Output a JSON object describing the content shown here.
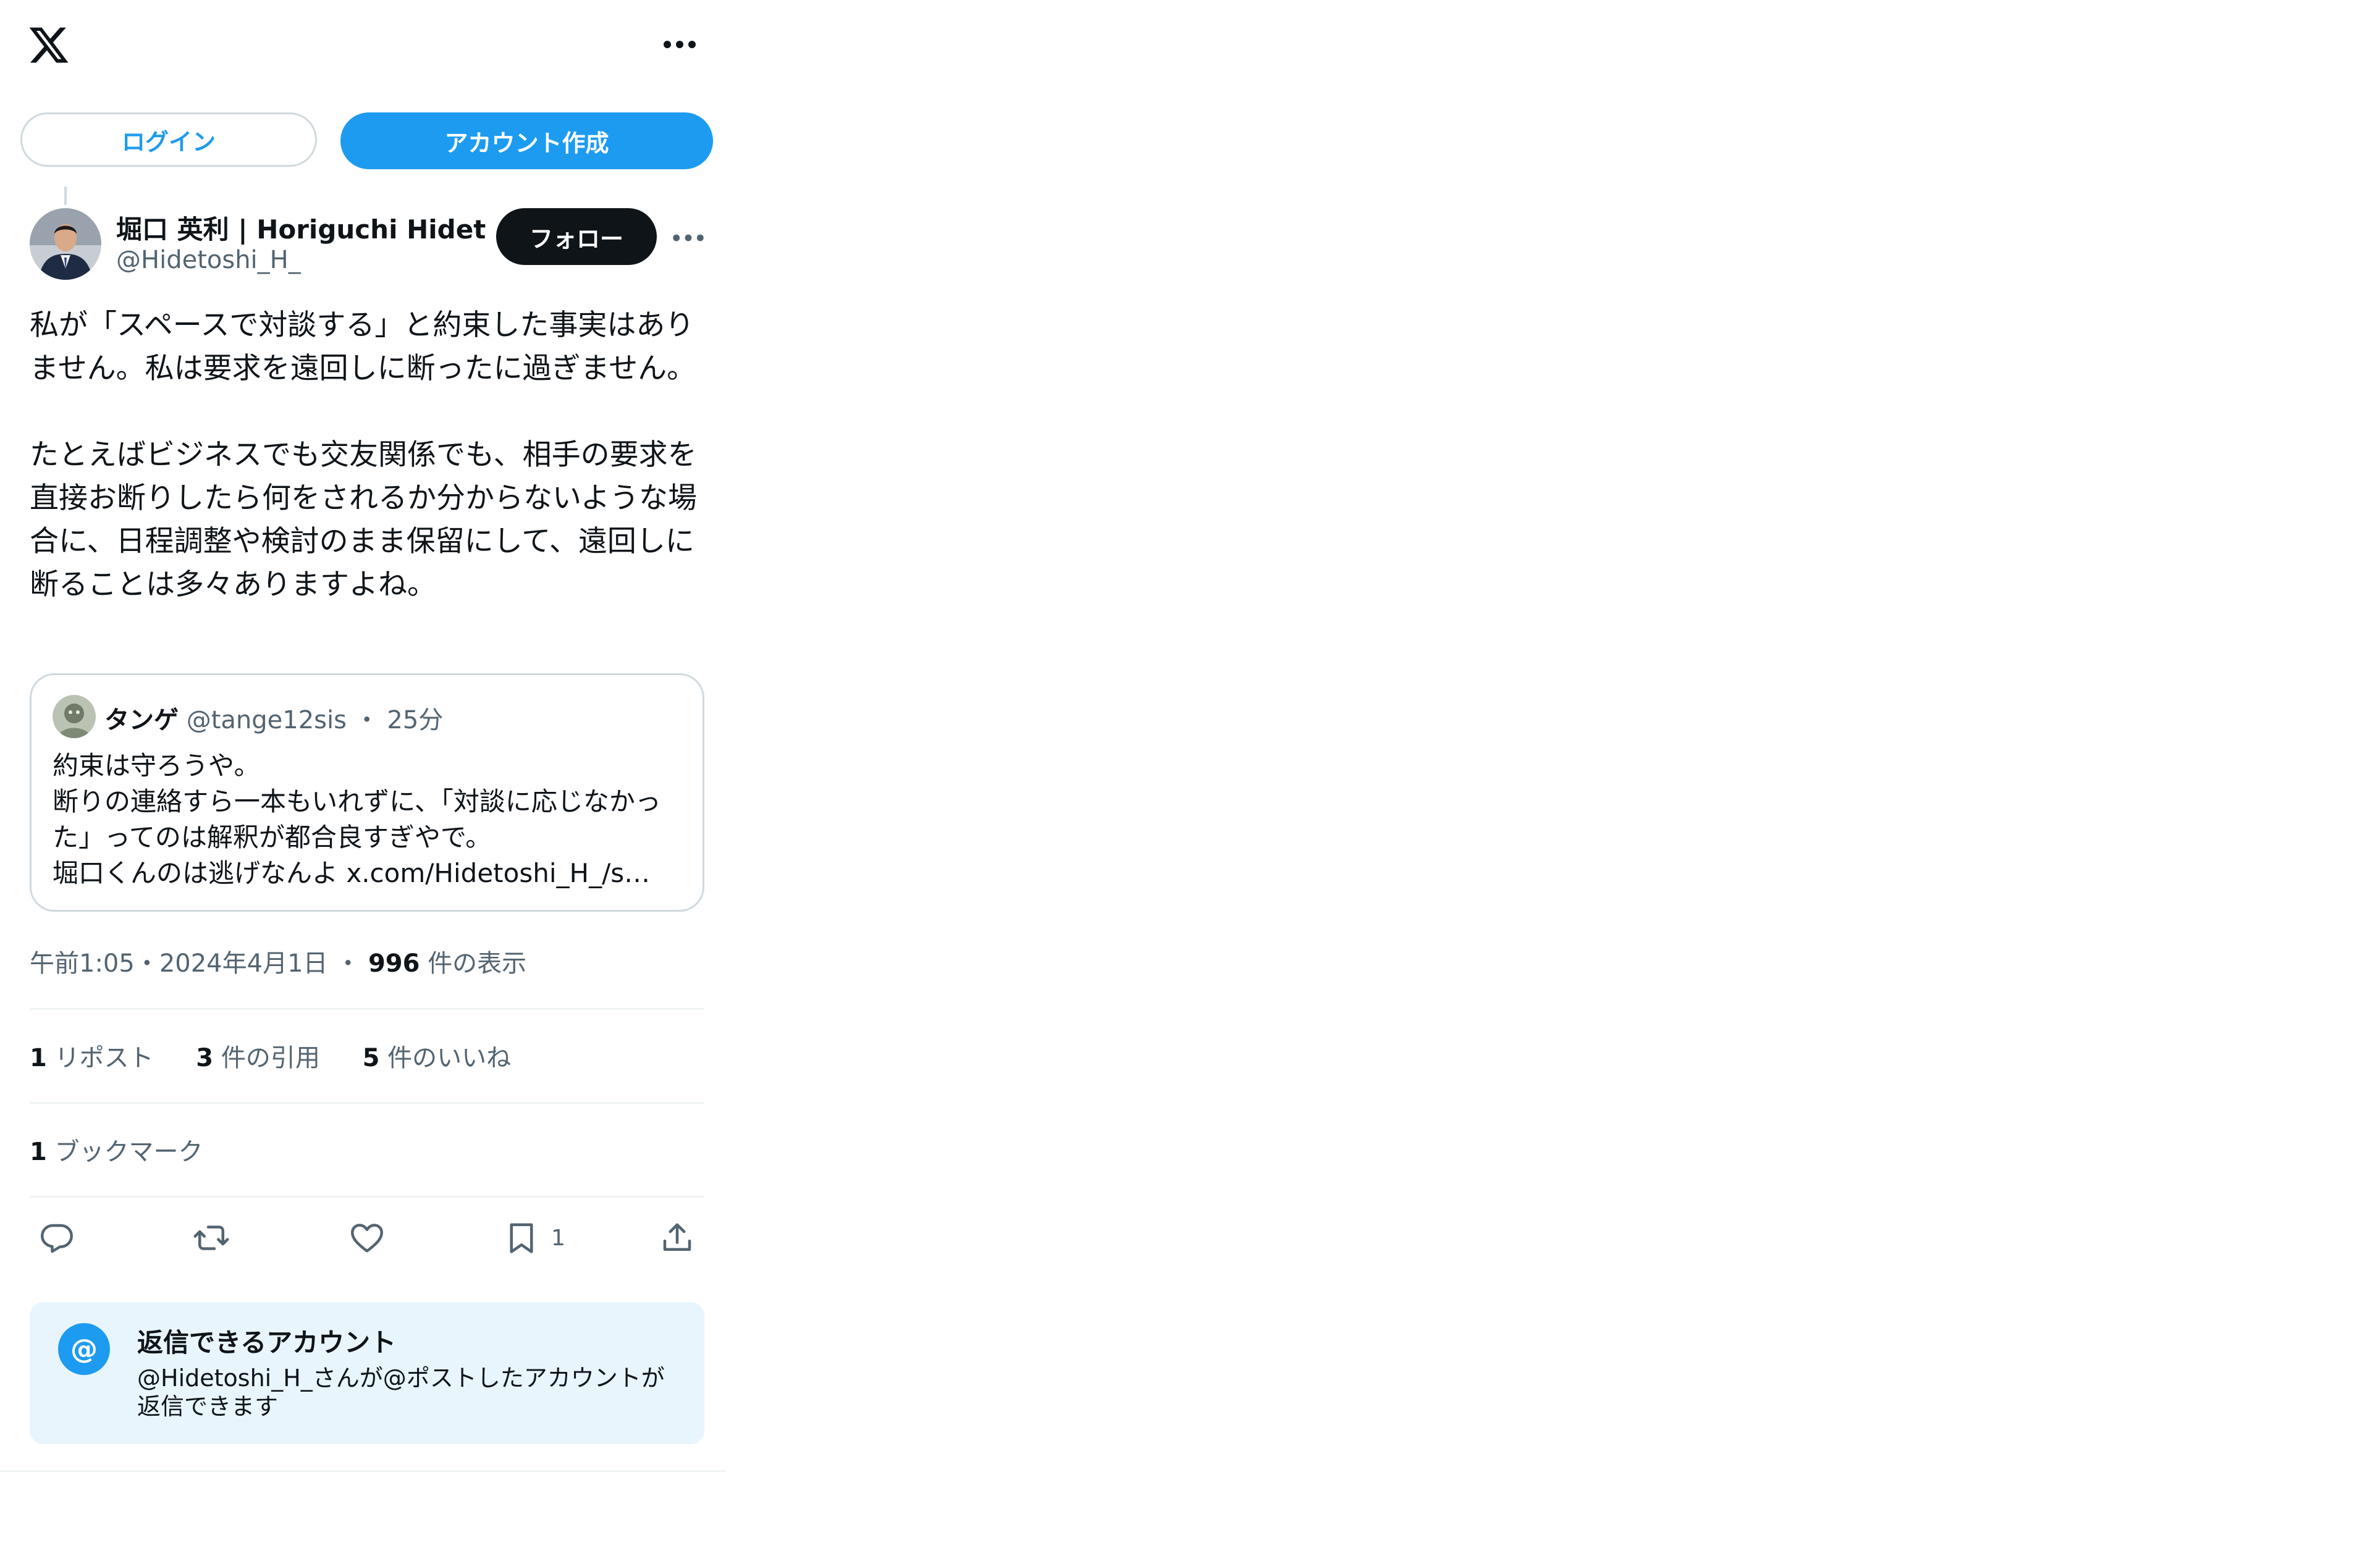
{
  "app": {
    "logo_icon": "x-logo-icon",
    "more_icon": "more-horizontal-icon"
  },
  "header": {
    "login_label": "ログイン",
    "signup_label": "アカウント作成"
  },
  "tweet": {
    "author_name": "堀口 英利 | Horiguchi Hidetos",
    "author_handle": "@Hidetoshi_H_",
    "follow_label": "フォロー",
    "text": "私が「スペースで対談する」と約束した事実はありません。私は要求を遠回しに断ったに過ぎません。\n\nたとえばビジネスでも交友関係でも、相手の要求を直接お断りしたら何をされるか分からないような場合に、日程調整や検討のまま保留にして、遠回しに断ることは多々ありますよね。",
    "timestamp": "午前1:05・2024年4月1日",
    "views_count": "996",
    "views_label": "件の表示"
  },
  "quote": {
    "name": "タンゲ",
    "handle": "@tange12sis",
    "separator": "・",
    "time": "25分",
    "text": "約束は守ろうや。\n断りの連絡すら一本もいれずに、「対談に応じなかった」ってのは解釈が都合良すぎやで。\n堀口くんのは逃げなんよ x.com/Hidetoshi_H_/s…"
  },
  "stats": {
    "reposts_count": "1",
    "reposts_label": "リポスト",
    "quotes_count": "3",
    "quotes_label": "件の引用",
    "likes_count": "5",
    "likes_label": "件のいいね",
    "bookmarks_count": "1",
    "bookmarks_label": "ブックマーク"
  },
  "actions": {
    "reply_icon": "reply-icon",
    "repost_icon": "repost-icon",
    "like_icon": "like-icon",
    "bookmark_icon": "bookmark-icon",
    "bookmark_count": "1",
    "share_icon": "share-icon"
  },
  "reply_restriction": {
    "icon_text": "@",
    "title": "返信できるアカウント",
    "description": "@Hidetoshi_H_さんが@ポストしたアカウントが返信できます"
  },
  "colors": {
    "accent": "#1d9bf0",
    "text_primary": "#0f1419",
    "text_secondary": "#536471",
    "border": "#cfd9de",
    "divider": "#eff3f4",
    "reply_box_bg": "#e8f5fd"
  }
}
